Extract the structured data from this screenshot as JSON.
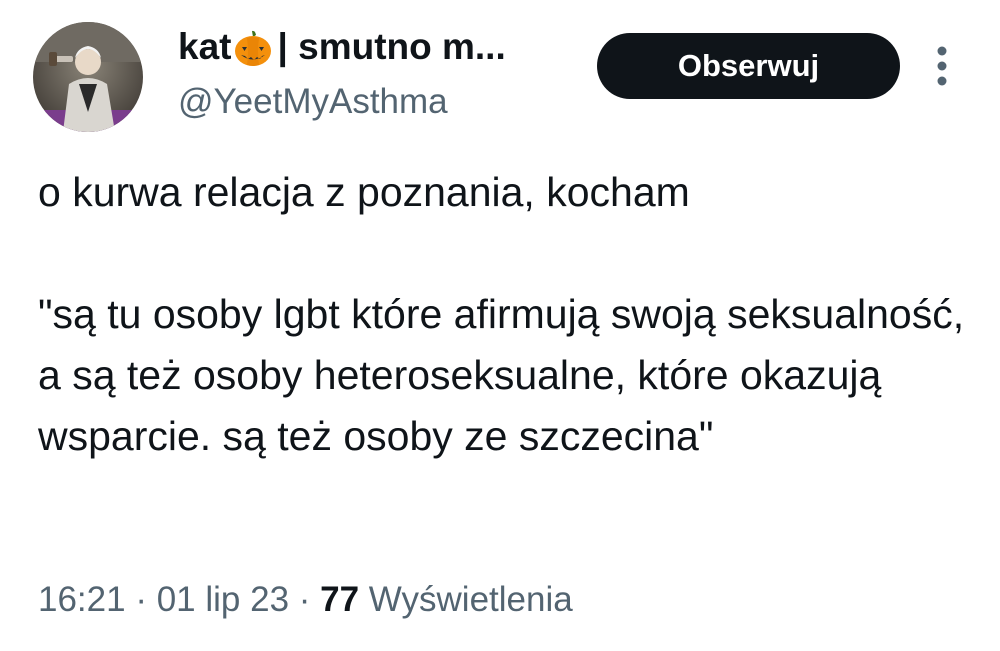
{
  "author": {
    "display_name": "kat",
    "display_name_suffix": " | smutno m...",
    "handle": "@YeetMyAsthma",
    "name_emoji": "pumpkin-icon",
    "avatar_icon": "profile-photo"
  },
  "actions": {
    "follow_label": "Obserwuj",
    "more_icon": "more-vertical-icon"
  },
  "tweet": {
    "text": "o kurwa relacja z poznania, kocham\n\n\"są tu osoby lgbt które afirmują swoją seksualność,  a są też osoby heteroseksualne, które okazują wsparcie. są też osoby ze szczecina\""
  },
  "meta": {
    "time": "16:21",
    "separator": " · ",
    "date": "01 lip 23",
    "views_count": "77",
    "views_label": " Wyświetlenia"
  },
  "colors": {
    "text": "#0f1419",
    "secondary": "#536471",
    "button_bg": "#0f1419",
    "button_text": "#ffffff",
    "pumpkin": "#f4900c"
  }
}
